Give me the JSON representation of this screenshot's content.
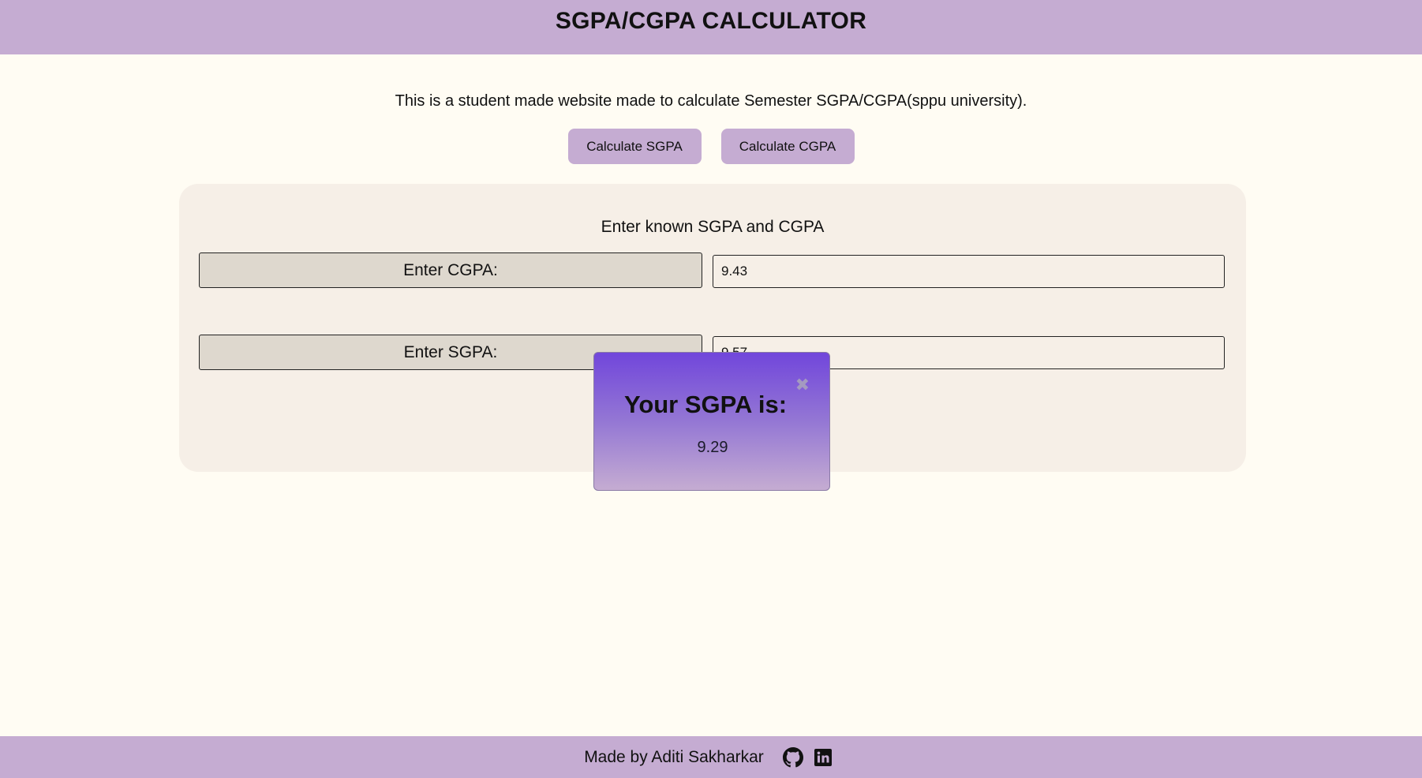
{
  "header": {
    "title": "SGPA/CGPA CALCULATOR"
  },
  "intro": {
    "text": "This is a student made website made to calculate Semester SGPA/CGPA(sppu university)."
  },
  "mode_buttons": {
    "sgpa_label": "Calculate SGPA",
    "cgpa_label": "Calculate CGPA"
  },
  "panel": {
    "title": "Enter known SGPA and CGPA",
    "cgpa_label": "Enter CGPA:",
    "cgpa_value": "9.43",
    "sgpa_label": "Enter SGPA:",
    "sgpa_value": "9.57"
  },
  "popup": {
    "close_glyph": "✖",
    "title": "Your SGPA is:",
    "value": "9.29"
  },
  "footer": {
    "credit": "Made by Aditi Sakharkar",
    "icons": [
      "github-icon",
      "linkedin-icon"
    ]
  },
  "colors": {
    "accent": "#c5acd2",
    "background": "#fffcf3",
    "panel": "#f6efe7",
    "popup_top": "#7146db"
  }
}
